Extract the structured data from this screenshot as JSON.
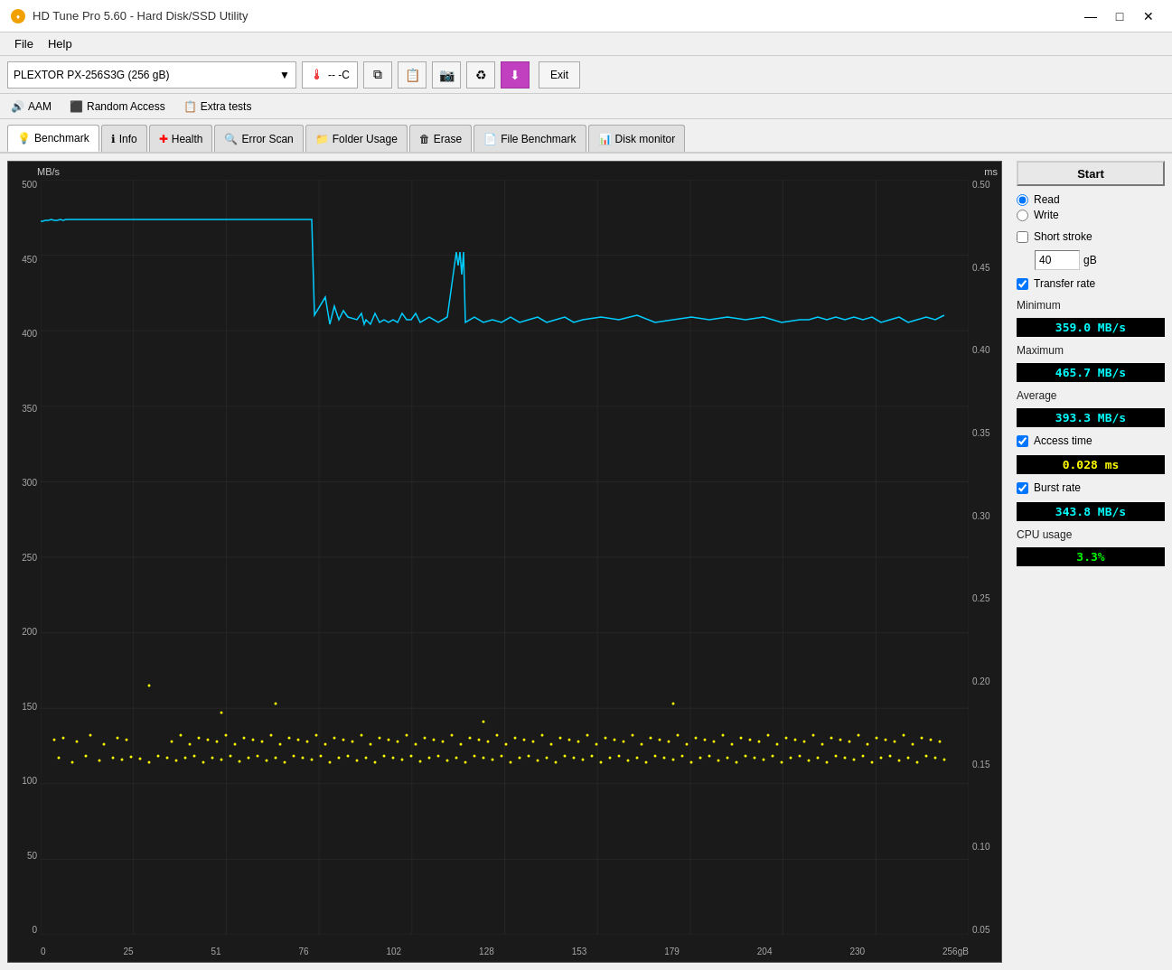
{
  "window": {
    "title": "HD Tune Pro 5.60 - Hard Disk/SSD Utility",
    "icon": "🔶"
  },
  "titlebar": {
    "minimize": "—",
    "maximize": "□",
    "close": "✕"
  },
  "menu": {
    "items": [
      "File",
      "Help"
    ]
  },
  "toolbar": {
    "drive_name": "PLEXTOR PX-256S3G (256 gB)",
    "temp_value": "-- -C",
    "exit_label": "Exit"
  },
  "secondary_toolbar": {
    "items": [
      "AAM",
      "Random Access",
      "Extra tests"
    ]
  },
  "tabs": [
    {
      "id": "benchmark",
      "label": "Benchmark",
      "icon": "💡",
      "active": true
    },
    {
      "id": "info",
      "label": "Info",
      "icon": "ℹ️"
    },
    {
      "id": "health",
      "label": "Health",
      "icon": "➕"
    },
    {
      "id": "error-scan",
      "label": "Error Scan",
      "icon": "🔍"
    },
    {
      "id": "folder-usage",
      "label": "Folder Usage",
      "icon": "📁"
    },
    {
      "id": "erase",
      "label": "Erase",
      "icon": "🗑️"
    },
    {
      "id": "file-benchmark",
      "label": "File Benchmark",
      "icon": "📄"
    },
    {
      "id": "disk-monitor",
      "label": "Disk monitor",
      "icon": "📊"
    }
  ],
  "side_panel": {
    "start_label": "Start",
    "read_label": "Read",
    "write_label": "Write",
    "short_stroke_label": "Short stroke",
    "short_stroke_value": "40",
    "short_stroke_unit": "gB",
    "transfer_rate_label": "Transfer rate",
    "minimum_label": "Minimum",
    "minimum_value": "359.0 MB/s",
    "maximum_label": "Maximum",
    "maximum_value": "465.7 MB/s",
    "average_label": "Average",
    "average_value": "393.3 MB/s",
    "access_time_label": "Access time",
    "access_time_value": "0.028 ms",
    "burst_rate_label": "Burst rate",
    "burst_rate_value": "343.8 MB/s",
    "cpu_usage_label": "CPU usage",
    "cpu_usage_value": "3.3%"
  },
  "chart": {
    "y_left_label": "MB/s",
    "y_right_label": "ms",
    "y_ticks_left": [
      "500",
      "450",
      "400",
      "350",
      "300",
      "250",
      "200",
      "150",
      "100",
      "50",
      "0"
    ],
    "y_ticks_right": [
      "0.50",
      "0.45",
      "0.40",
      "0.35",
      "0.30",
      "0.25",
      "0.20",
      "0.15",
      "0.10",
      "0.05"
    ],
    "x_ticks": [
      "0",
      "25",
      "51",
      "76",
      "102",
      "128",
      "153",
      "179",
      "204",
      "230",
      "256gB"
    ]
  }
}
